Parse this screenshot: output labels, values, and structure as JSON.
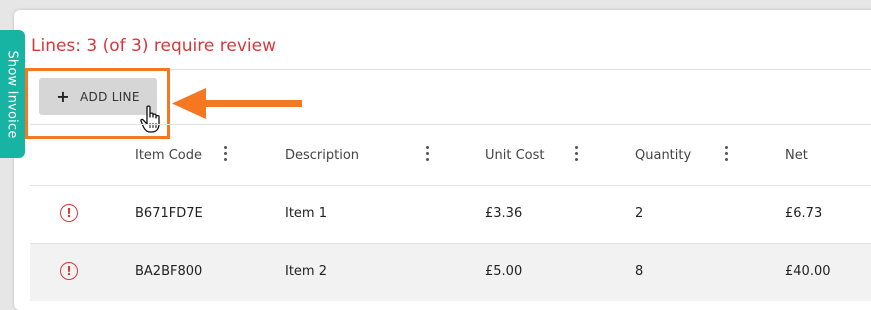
{
  "side_tab": {
    "label": "Show Invoice"
  },
  "lines_status": "Lines: 3 (of 3) require review",
  "add_line_button": {
    "icon": "+",
    "label": "ADD LINE"
  },
  "annotation": {
    "color": "#f57722"
  },
  "colors": {
    "accent": "#17b3a3",
    "error": "#d9383a",
    "highlight": "#f57722"
  },
  "table": {
    "columns": [
      "Item Code",
      "Description",
      "Unit Cost",
      "Quantity",
      "Net"
    ],
    "rows": [
      {
        "status_icon": "!",
        "item_code": "B671FD7E",
        "description": "Item 1",
        "unit_cost": "£3.36",
        "quantity": "2",
        "net": "£6.73"
      },
      {
        "status_icon": "!",
        "item_code": "BA2BF800",
        "description": "Item 2",
        "unit_cost": "£5.00",
        "quantity": "8",
        "net": "£40.00"
      }
    ]
  }
}
